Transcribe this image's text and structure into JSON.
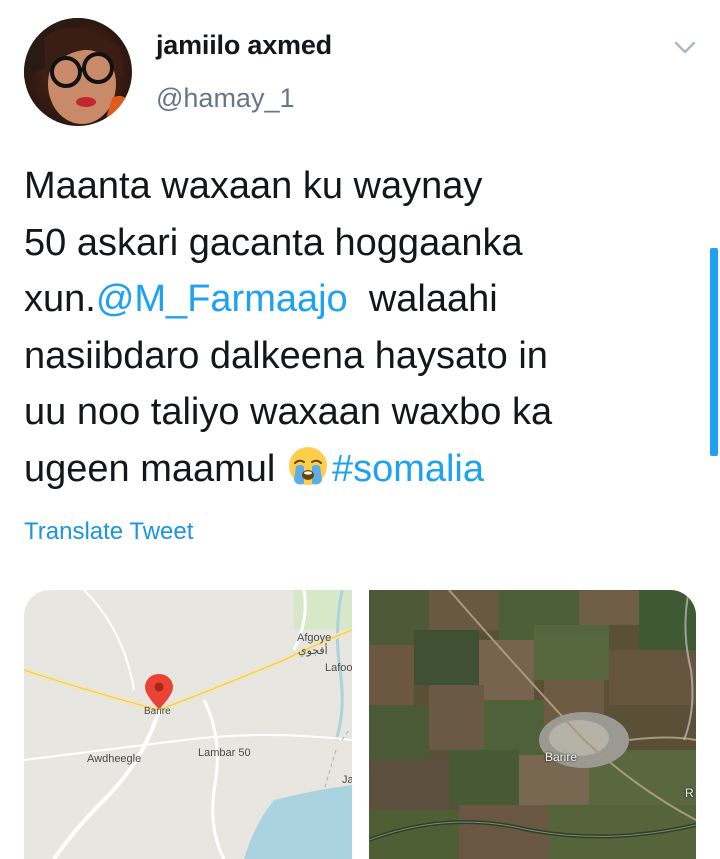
{
  "tweet": {
    "author_name": "jamiilo axmed",
    "author_handle": "@hamay_1",
    "text_lines": [
      {
        "pre": "Maanta waxaan ku waynay",
        "link": "",
        "post": ""
      },
      {
        "pre": "50 askari gacanta hoggaanka",
        "link": "",
        "post": ""
      },
      {
        "pre": "xun.",
        "link": "@M_Farmaajo",
        "post": "  walaahi"
      },
      {
        "pre": "nasiibdaro dalkeena haysato in",
        "link": "",
        "post": ""
      },
      {
        "pre": "uu noo taliyo waxaan waxbo ka",
        "link": "",
        "post": ""
      },
      {
        "pre": "ugeen maamul ",
        "link": "#somalia",
        "post": ""
      }
    ],
    "emoji": "loudly-crying-face",
    "translate_label": "Translate Tweet"
  },
  "map": {
    "labels": {
      "afgoye": "Afgoye",
      "afgoye_arabic": "أفجوي",
      "lafoole": "Lafoo",
      "barire": "Barire",
      "awdheegle": "Awdheegle",
      "lambar50": "Lambar 50",
      "ja": "Ja"
    }
  },
  "satellite": {
    "labels": {
      "barire": "Barire",
      "edge": "R"
    }
  },
  "colors": {
    "link": "#1da1f2",
    "text": "#14171a",
    "secondary": "#657786"
  }
}
